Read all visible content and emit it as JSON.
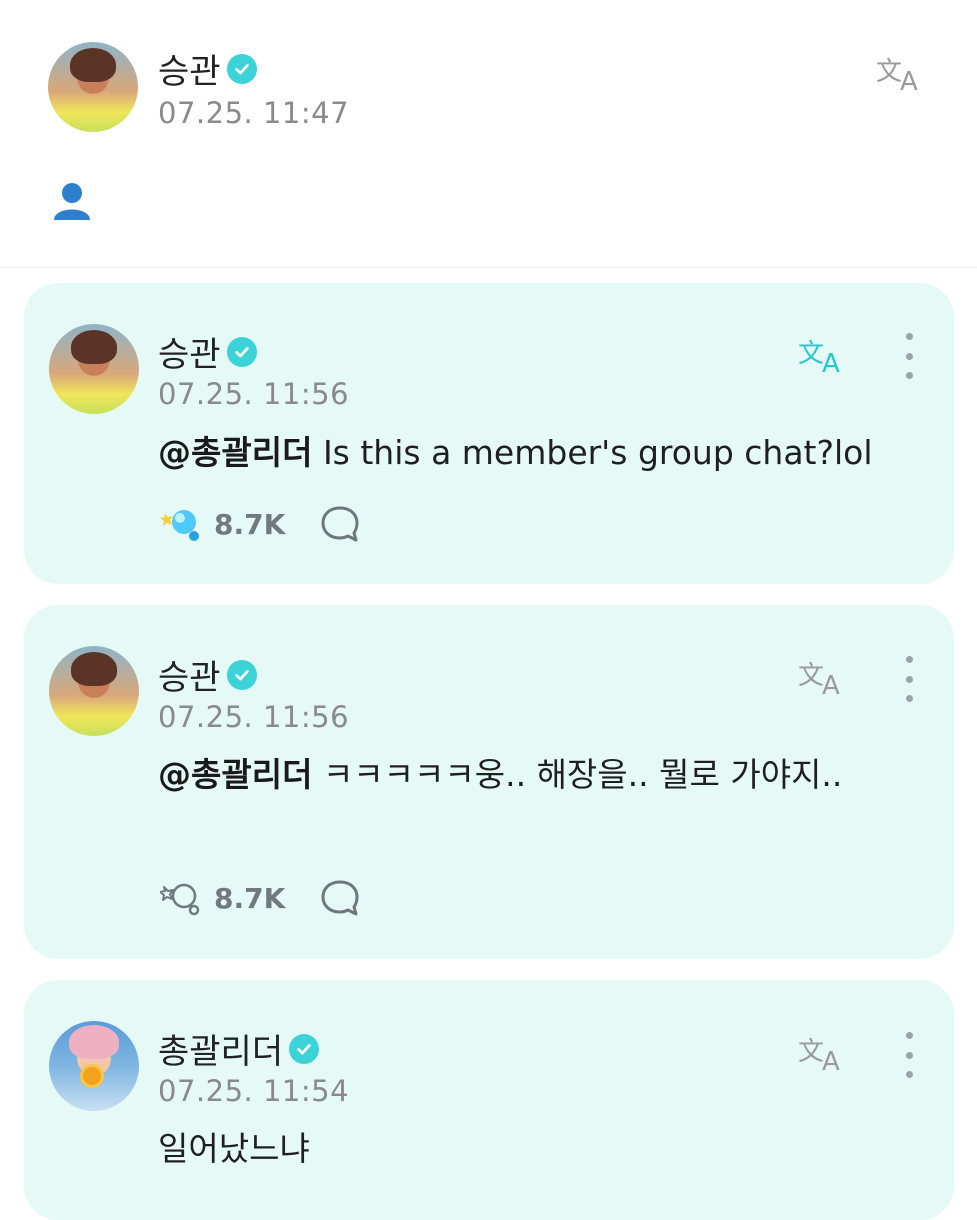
{
  "top_post": {
    "author": "승관",
    "time": "07.25. 11:47",
    "body_emoji": "👤"
  },
  "comments": [
    {
      "author": "승관",
      "time": "07.25. 11:56",
      "mention": "@총괄리더",
      "text": " Is this a member's group chat?lol",
      "likes": "8.7K",
      "translate_active": true,
      "like_active": true
    },
    {
      "author": "승관",
      "time": "07.25. 11:56",
      "mention": "@총괄리더",
      "text": " ㅋㅋㅋㅋㅋ웅.. 해장을.. 뭘로 가야지..",
      "likes": "8.7K",
      "translate_active": false,
      "like_active": false
    },
    {
      "author": "총괄리더",
      "time": "07.25. 11:54",
      "text": "일어났느냐",
      "translate_active": false
    }
  ],
  "colors": {
    "accent": "#3bd3d8",
    "card_bg": "#e5faf6",
    "muted": "#8a8a8a"
  },
  "icons": [
    "verified-badge-icon",
    "translate-icon",
    "more-options-icon",
    "like-lightstick-icon",
    "comment-bubble-icon",
    "person-emoji-icon"
  ]
}
